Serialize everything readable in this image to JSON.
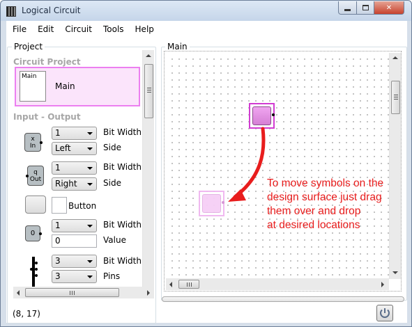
{
  "window": {
    "title": "Logical Circuit"
  },
  "menu": {
    "items": [
      "File",
      "Edit",
      "Circuit",
      "Tools",
      "Help"
    ]
  },
  "project_panel": {
    "group_label": "Project",
    "section_circuit_project": "Circuit Project",
    "project_thumb_label": "Main",
    "project_name": "Main",
    "section_input_output": "Input - Output",
    "symbols": [
      {
        "icon": "input-pin-icon",
        "label": "x\nIn",
        "fields": [
          {
            "type": "combo",
            "value": "1",
            "caption": "Bit Width"
          },
          {
            "type": "combo",
            "value": "Left",
            "caption": "Side"
          }
        ]
      },
      {
        "icon": "output-pin-icon",
        "label": "q\nOut",
        "fields": [
          {
            "type": "combo",
            "value": "1",
            "caption": "Bit Width"
          },
          {
            "type": "combo",
            "value": "Right",
            "caption": "Side"
          }
        ]
      },
      {
        "icon": "button-icon",
        "label": "",
        "fields": [
          {
            "type": "text",
            "value": "",
            "caption": "Button"
          }
        ]
      },
      {
        "icon": "constant-icon",
        "label": "0",
        "fields": [
          {
            "type": "combo",
            "value": "1",
            "caption": "Bit Width"
          },
          {
            "type": "text",
            "value": "0",
            "caption": "Value"
          }
        ]
      },
      {
        "icon": "splitter-icon",
        "label": "",
        "fields": [
          {
            "type": "combo",
            "value": "3",
            "caption": "Bit Width"
          },
          {
            "type": "combo",
            "value": "3",
            "caption": "Pins"
          }
        ]
      }
    ]
  },
  "main_panel": {
    "group_label": "Main",
    "annotation": "To move symbols on the\ndesign surface just drag\nthem over and drop\nat desired locations",
    "annotation_color": "#e81d1d"
  },
  "status": {
    "coordinates": "(8, 17)"
  },
  "colors": {
    "selection_pink": "#e07ce0",
    "symbol_gray": "#b7bfc3",
    "arrow_red": "#e81d1d"
  }
}
